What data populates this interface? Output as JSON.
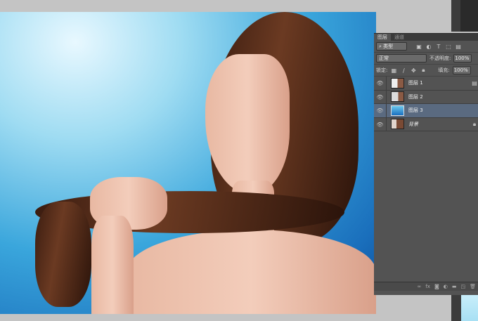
{
  "tabs": [
    {
      "label": "图层"
    },
    {
      "label": "通道"
    }
  ],
  "filter": {
    "label": "类型"
  },
  "blend_mode": "正常",
  "opacity": {
    "label": "不透明度:",
    "value": "100%"
  },
  "lock": {
    "label": "锁定:"
  },
  "fill": {
    "label": "填充:",
    "value": "100%"
  },
  "layers": [
    {
      "name": "图层 1",
      "visible": true,
      "selected": false
    },
    {
      "name": "图层 2",
      "visible": true,
      "selected": false
    },
    {
      "name": "图层 3",
      "visible": true,
      "selected": true
    },
    {
      "name": "背景",
      "visible": true,
      "selected": false,
      "locked": true
    }
  ],
  "footer_icons": [
    "link-icon",
    "fx-icon",
    "mask-icon",
    "adjustment-icon",
    "folder-icon",
    "new-layer-icon",
    "trash-icon"
  ]
}
